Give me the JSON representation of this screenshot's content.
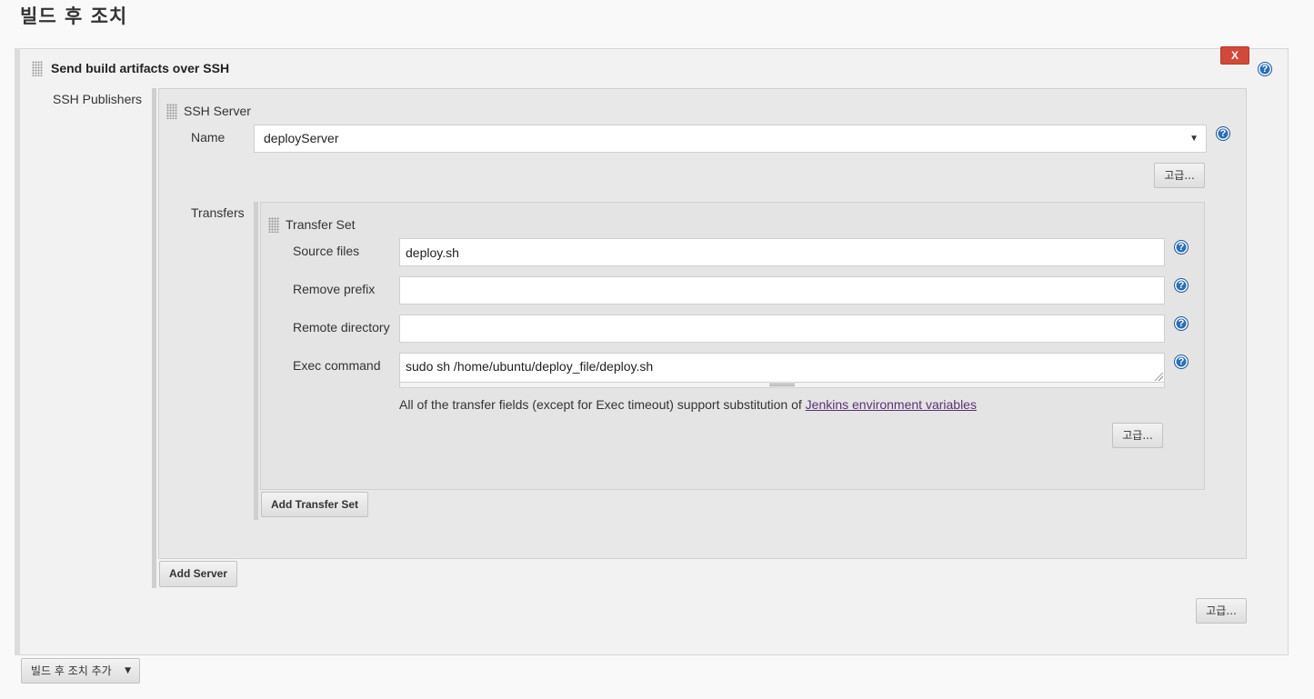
{
  "section": {
    "title": "빌드 후 조치"
  },
  "step": {
    "title": "Send build artifacts over SSH",
    "delete_label": "X",
    "ssh_publishers_label": "SSH Publishers",
    "advanced_label": "고급..."
  },
  "server": {
    "title": "SSH Server",
    "name_label": "Name",
    "name_value": "deployServer",
    "advanced_label": "고급...",
    "transfers_label": "Transfers",
    "add_server_label": "Add Server"
  },
  "transfer_set": {
    "title": "Transfer Set",
    "source_files_label": "Source files",
    "source_files_value": "deploy.sh",
    "remove_prefix_label": "Remove prefix",
    "remove_prefix_value": "",
    "remote_directory_label": "Remote directory",
    "remote_directory_value": "",
    "exec_command_label": "Exec command",
    "exec_command_value": "sudo sh /home/ubuntu/deploy_file/deploy.sh",
    "info_text": "All of the transfer fields (except for Exec timeout) support substitution of ",
    "info_link": "Jenkins environment variables",
    "advanced_label": "고급...",
    "add_transfer_set_label": "Add Transfer Set"
  },
  "footer": {
    "add_post_build_label": "빌드 후 조치 추가"
  },
  "icons": {
    "help": "help-icon",
    "drag": "drag-handle-icon",
    "dropdown": "caret-down-icon"
  },
  "colors": {
    "delete": "#d24939",
    "help": "#2b6fb5",
    "link": "#5a3474"
  }
}
